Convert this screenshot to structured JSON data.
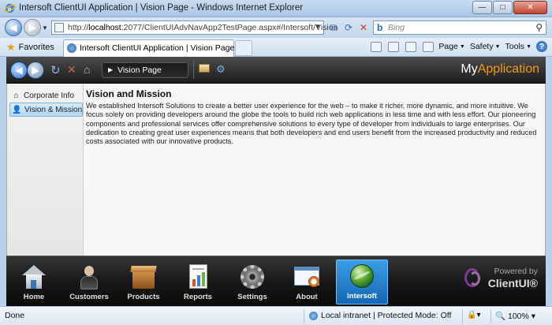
{
  "window": {
    "title": "Intersoft ClientUI Application | Vision Page - Windows Internet Explorer",
    "minimize_label": "—",
    "maximize_label": "□",
    "close_label": "✕"
  },
  "addressbar": {
    "url_prefix": "http://",
    "url_host": "localhost",
    "url_rest": ":2077/ClientUIAdvNavApp2TestPage.aspx#/Intersoft/Vision",
    "search_placeholder": "Bing"
  },
  "tabbar": {
    "favorites_label": "Favorites",
    "tab_label": "Intersoft ClientUI Application | Vision Page",
    "commands": [
      "Page",
      "Safety",
      "Tools"
    ]
  },
  "app": {
    "breadcrumb": "Vision Page",
    "brand_my": "My",
    "brand_app": "Application"
  },
  "sidenav": {
    "items": [
      {
        "label": "Corporate Info",
        "icon": "home-icon"
      },
      {
        "label": "Vision & Mission",
        "icon": "person-icon"
      }
    ]
  },
  "content": {
    "heading": "Vision and Mission",
    "body": "We established Intersoft Solutions to create a better user experience for the web – to make it richer, more dynamic, and more intuitive. We focus solely on providing developers around the globe the tools to build rich web applications in less time and with less effort. Our pioneering components and professional services offer comprehensive solutions to every type of developer from individuals to large enterprises. Our dedication to creating great user experiences means that both developers and end users benefit from the increased productivity and reduced costs associated with our innovative products."
  },
  "dock": {
    "items": [
      {
        "label": "Home",
        "icon": "home-icon"
      },
      {
        "label": "Customers",
        "icon": "customers-icon"
      },
      {
        "label": "Products",
        "icon": "products-icon"
      },
      {
        "label": "Reports",
        "icon": "reports-icon"
      },
      {
        "label": "Settings",
        "icon": "settings-icon"
      },
      {
        "label": "About",
        "icon": "about-icon"
      },
      {
        "label": "Intersoft",
        "icon": "intersoft-globe-icon"
      }
    ],
    "active": "Intersoft",
    "powered_by_line1": "Powered by",
    "powered_by_line2": "ClientUI®"
  },
  "statusbar": {
    "text": "Done",
    "zone": "Local intranet | Protected Mode: Off",
    "zoom": "100%"
  },
  "colors": {
    "accent_orange": "#f39a1e",
    "active_dock_blue": "#1f7fd0"
  }
}
